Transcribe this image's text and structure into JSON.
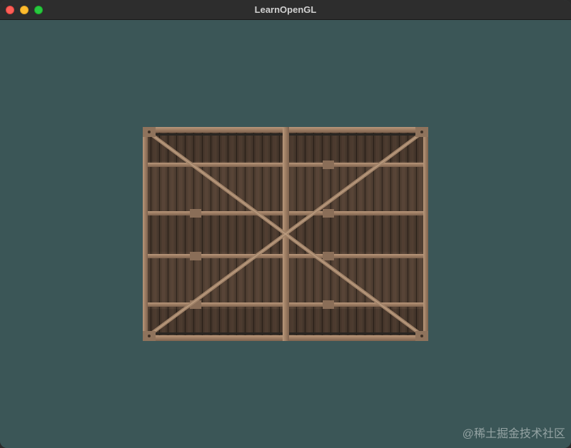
{
  "window": {
    "title": "LearnOpenGL",
    "controls": {
      "close": "close-icon",
      "minimize": "minimize-icon",
      "zoom": "zoom-icon"
    }
  },
  "canvas": {
    "clear_color": "#3b5657",
    "quad_texture": "wooden-container-texture"
  },
  "watermark": {
    "text": "@稀土掘金技术社区"
  }
}
